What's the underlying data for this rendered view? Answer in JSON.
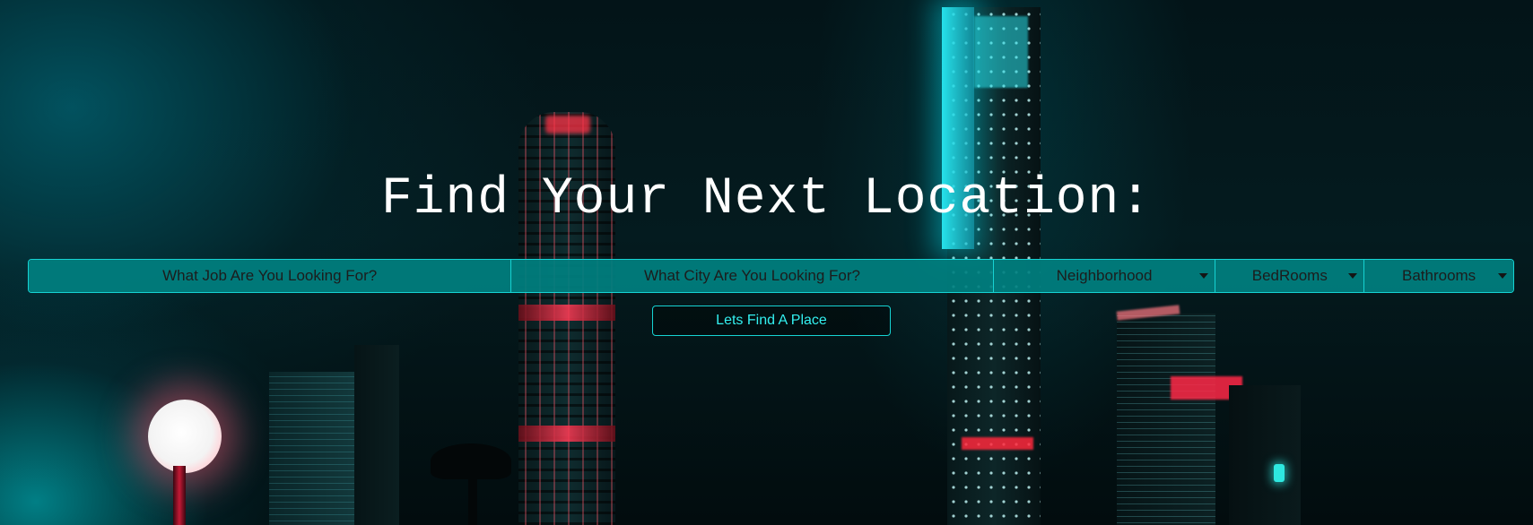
{
  "hero": {
    "title": "Find Your Next Location:"
  },
  "search": {
    "job_placeholder": "What Job Are You Looking For?",
    "city_placeholder": "What City Are You Looking For?",
    "neighborhood_select": "Neighborhood",
    "bedrooms_select": "BedRooms",
    "bathrooms_select": "Bathrooms"
  },
  "actions": {
    "submit_label": "Lets Find A Place"
  },
  "colors": {
    "accent": "#16d3d3",
    "field_background": "#008080",
    "button_text": "#33f0f0",
    "title_text": "#ffffff"
  },
  "icons": {
    "dropdown": "caret-down-icon"
  }
}
